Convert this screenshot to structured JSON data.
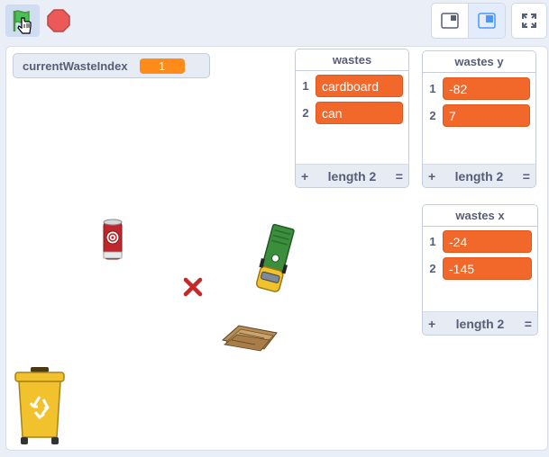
{
  "toolbar": {
    "green_flag_icon": "green-flag-icon",
    "stop_icon": "stop-sign-icon",
    "colors": {
      "flag": "#4caf50",
      "stop": "#ec5959",
      "accent": "#4c97ff"
    }
  },
  "stage": {
    "variable_monitor": {
      "name": "currentWasteIndex",
      "value": "1"
    },
    "lists": [
      {
        "title": "wastes",
        "items": [
          {
            "index": "1",
            "value": "cardboard"
          },
          {
            "index": "2",
            "value": "can"
          }
        ],
        "footer": {
          "add": "+",
          "length": "length 2",
          "resize": "="
        }
      },
      {
        "title": "wastes y",
        "items": [
          {
            "index": "1",
            "value": "-82"
          },
          {
            "index": "2",
            "value": "7"
          }
        ],
        "footer": {
          "add": "+",
          "length": "length 2",
          "resize": "="
        }
      },
      {
        "title": "wastes x",
        "items": [
          {
            "index": "1",
            "value": "-24"
          },
          {
            "index": "2",
            "value": "-145"
          }
        ],
        "footer": {
          "add": "+",
          "length": "length 2",
          "resize": "="
        }
      }
    ],
    "sprites": [
      "can-sprite",
      "truck-sprite",
      "x-mark-sprite",
      "cardboard-sprite",
      "recycle-bin-sprite"
    ]
  }
}
